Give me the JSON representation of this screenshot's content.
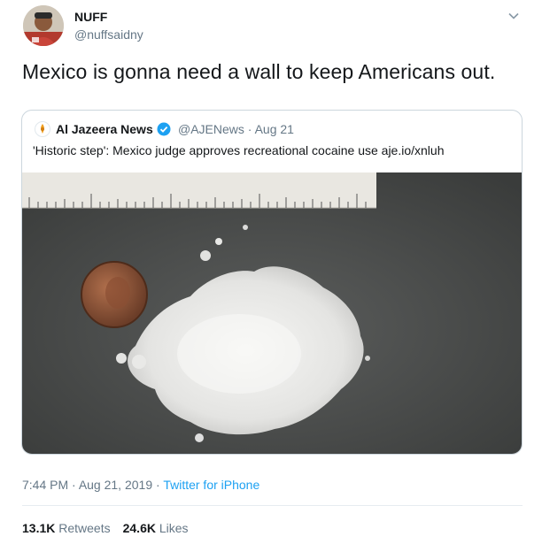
{
  "author": {
    "name": "NUFF",
    "handle": "@nuffsaidny",
    "avatar_icon": "user-avatar"
  },
  "tweet": {
    "text": "Mexico is gonna need a wall to keep Americans out."
  },
  "quoted": {
    "name": "Al Jazeera News",
    "handle": "@AJENews",
    "date": "Aug 21",
    "handle_date": "@AJENews · Aug 21",
    "text": "'Historic step': Mexico judge approves recreational cocaine use aje.io/xnluh",
    "verified_icon": "verified-badge-icon",
    "media_description_icon": "photo-powder-ruler-penny"
  },
  "meta": {
    "time": "7:44 PM",
    "date": "Aug 21, 2019",
    "source": "Twitter for iPhone",
    "separator": " · "
  },
  "stats": {
    "retweets_count": "13.1K",
    "retweets_label": "Retweets",
    "likes_count": "24.6K",
    "likes_label": "Likes"
  },
  "colors": {
    "link": "#1da1f2",
    "secondary_text": "#657786",
    "border": "#ccd6dd"
  }
}
